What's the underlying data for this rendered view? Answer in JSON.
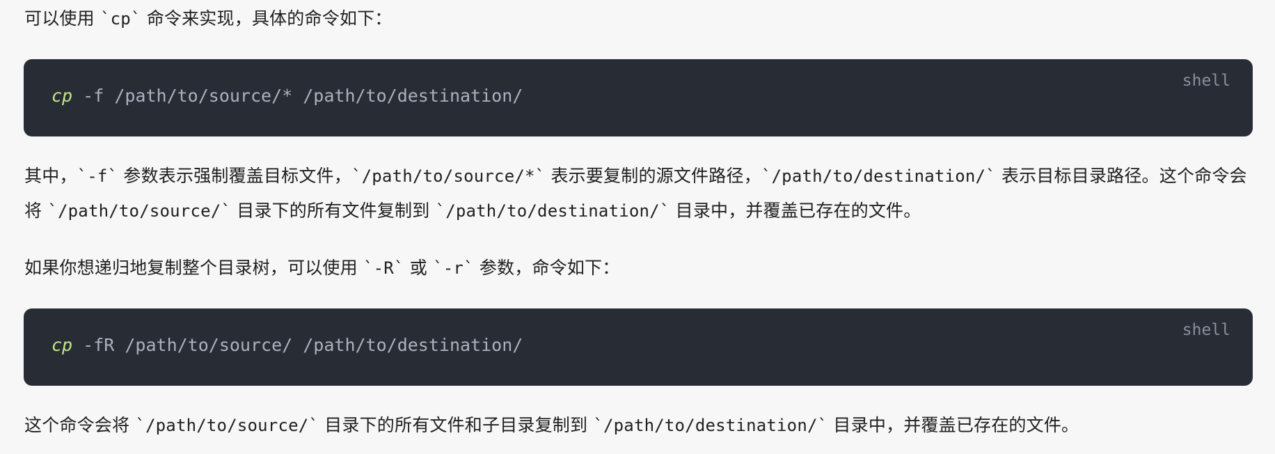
{
  "paragraphs": {
    "p1": {
      "before": "可以使用 ",
      "code": "`cp`",
      "after": " 命令来实现，具体的命令如下："
    },
    "p2": {
      "s1": "其中，",
      "c1": "`-f`",
      "s2": " 参数表示强制覆盖目标文件，",
      "c2": "`/path/to/source/*`",
      "s3": " 表示要复制的源文件路径，",
      "c3": "`/path/to/destination/`",
      "s4": " 表示目标目录路径。这个命令会将 ",
      "c4": "`/path/to/source/`",
      "s5": " 目录下的所有文件复制到 ",
      "c5": "`/path/to/destination/`",
      "s6": " 目录中，并覆盖已存在的文件。"
    },
    "p3": {
      "s1": "如果你想递归地复制整个目录树，可以使用 ",
      "c1": "`-R`",
      "s2": " 或 ",
      "c2": "`-r`",
      "s3": " 参数，命令如下："
    },
    "p4": {
      "s1": "这个命令会将 ",
      "c1": "`/path/to/source/`",
      "s2": " 目录下的所有文件和子目录复制到 ",
      "c2": "`/path/to/destination/`",
      "s3": " 目录中，并覆盖已存在的文件。"
    }
  },
  "code_blocks": [
    {
      "language": "shell",
      "command": "cp",
      "args": " -f /path/to/source/* /path/to/destination/"
    },
    {
      "language": "shell",
      "command": "cp",
      "args": " -fR /path/to/source/ /path/to/destination/"
    }
  ],
  "colors": {
    "code_bg": "#282c34",
    "command": "#c3e88d",
    "code_text": "#abb2bf",
    "lang_label": "#8a919e",
    "page_bg": "#f7f7f8"
  }
}
